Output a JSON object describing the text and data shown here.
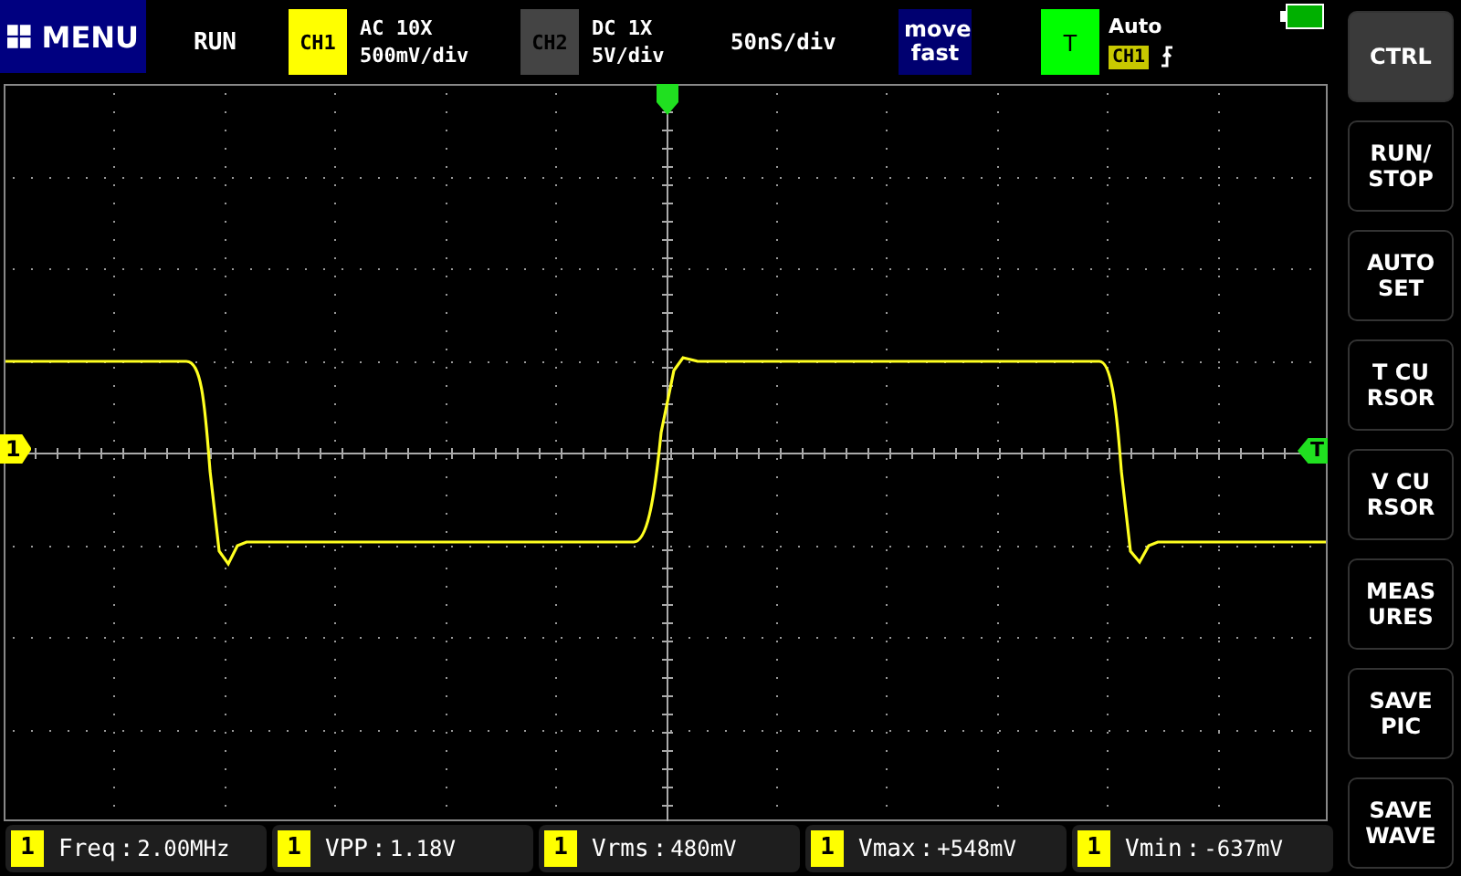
{
  "top_bar": {
    "menu": "MENU",
    "run_state": "RUN",
    "channels": [
      {
        "label": "CH1",
        "coupling": "AC  10X",
        "scale": "500mV/div",
        "color": "#ffff00"
      },
      {
        "label": "CH2",
        "coupling": "DC  1X",
        "scale": "5V/div",
        "color": "#444444"
      }
    ],
    "timebase": "50nS/div",
    "move_mode": [
      "move",
      "fast"
    ],
    "trigger": {
      "label": "T",
      "mode": "Auto",
      "source": "CH1"
    }
  },
  "screen": {
    "channel_marker": "1",
    "trigger_level_marker": "T"
  },
  "side_buttons": [
    {
      "lines": [
        "CTRL"
      ],
      "selected": true
    },
    {
      "lines": [
        "RUN/",
        "STOP"
      ],
      "selected": false
    },
    {
      "lines": [
        "AUTO",
        "SET"
      ],
      "selected": false
    },
    {
      "lines": [
        "T  CU",
        "RSOR"
      ],
      "selected": false
    },
    {
      "lines": [
        "V  CU",
        "RSOR"
      ],
      "selected": false
    },
    {
      "lines": [
        "MEAS",
        "URES"
      ],
      "selected": false
    },
    {
      "lines": [
        "SAVE",
        "PIC"
      ],
      "selected": false
    },
    {
      "lines": [
        "SAVE",
        "WAVE"
      ],
      "selected": false
    }
  ],
  "measurements": [
    {
      "channel": "1",
      "name": "Freq",
      "separator": ":",
      "value": "2.00MHz"
    },
    {
      "channel": "1",
      "name": "VPP",
      "separator": ":",
      "value": "1.18V"
    },
    {
      "channel": "1",
      "name": "Vrms",
      "separator": ":",
      "value": "480mV"
    },
    {
      "channel": "1",
      "name": "Vmax",
      "separator": ":",
      "value": "+548mV"
    },
    {
      "channel": "1",
      "name": "Vmin",
      "separator": ":",
      "value": "-637mV"
    }
  ]
}
